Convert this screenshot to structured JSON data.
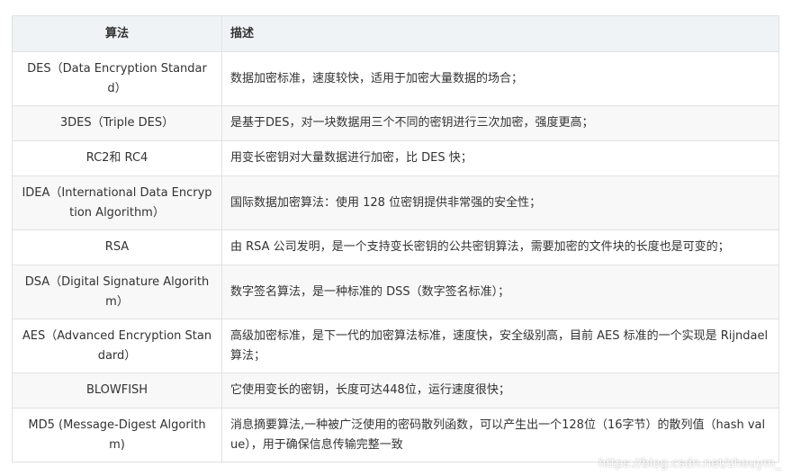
{
  "table": {
    "headers": [
      "算法",
      "描述"
    ],
    "rows": [
      {
        "algo": "DES（Data Encryption Standard）",
        "desc": "数据加密标准，速度较快，适用于加密大量数据的场合；"
      },
      {
        "algo": "3DES（Triple DES）",
        "desc": "是基于DES，对一块数据用三个不同的密钥进行三次加密，强度更高；"
      },
      {
        "algo": "RC2和 RC4",
        "desc": "用变长密钥对大量数据进行加密，比 DES 快；"
      },
      {
        "algo": "IDEA（International Data Encryption Algorithm）",
        "desc": "国际数据加密算法：使用 128 位密钥提供非常强的安全性；"
      },
      {
        "algo": "RSA",
        "desc": "由 RSA 公司发明，是一个支持变长密钥的公共密钥算法，需要加密的文件块的长度也是可变的；"
      },
      {
        "algo": "DSA（Digital Signature Algorithm）",
        "desc": "数字签名算法，是一种标准的 DSS（数字签名标准）；"
      },
      {
        "algo": "AES（Advanced Encryption Standard）",
        "desc": "高级加密标准，是下一代的加密算法标准，速度快，安全级别高，目前 AES 标准的一个实现是 Rijndael 算法；"
      },
      {
        "algo": "BLOWFISH",
        "desc": "它使用变长的密钥，长度可达448位，运行速度很快；"
      },
      {
        "algo": "MD5 (Message-Digest Algorithm)",
        "desc": "消息摘要算法,一种被广泛使用的密码散列函数，可以产生出一个128位（16字节）的散列值（hash value），用于确保信息传输完整一致"
      }
    ]
  },
  "watermark": "https://blog.csdn.net/zhouym_"
}
